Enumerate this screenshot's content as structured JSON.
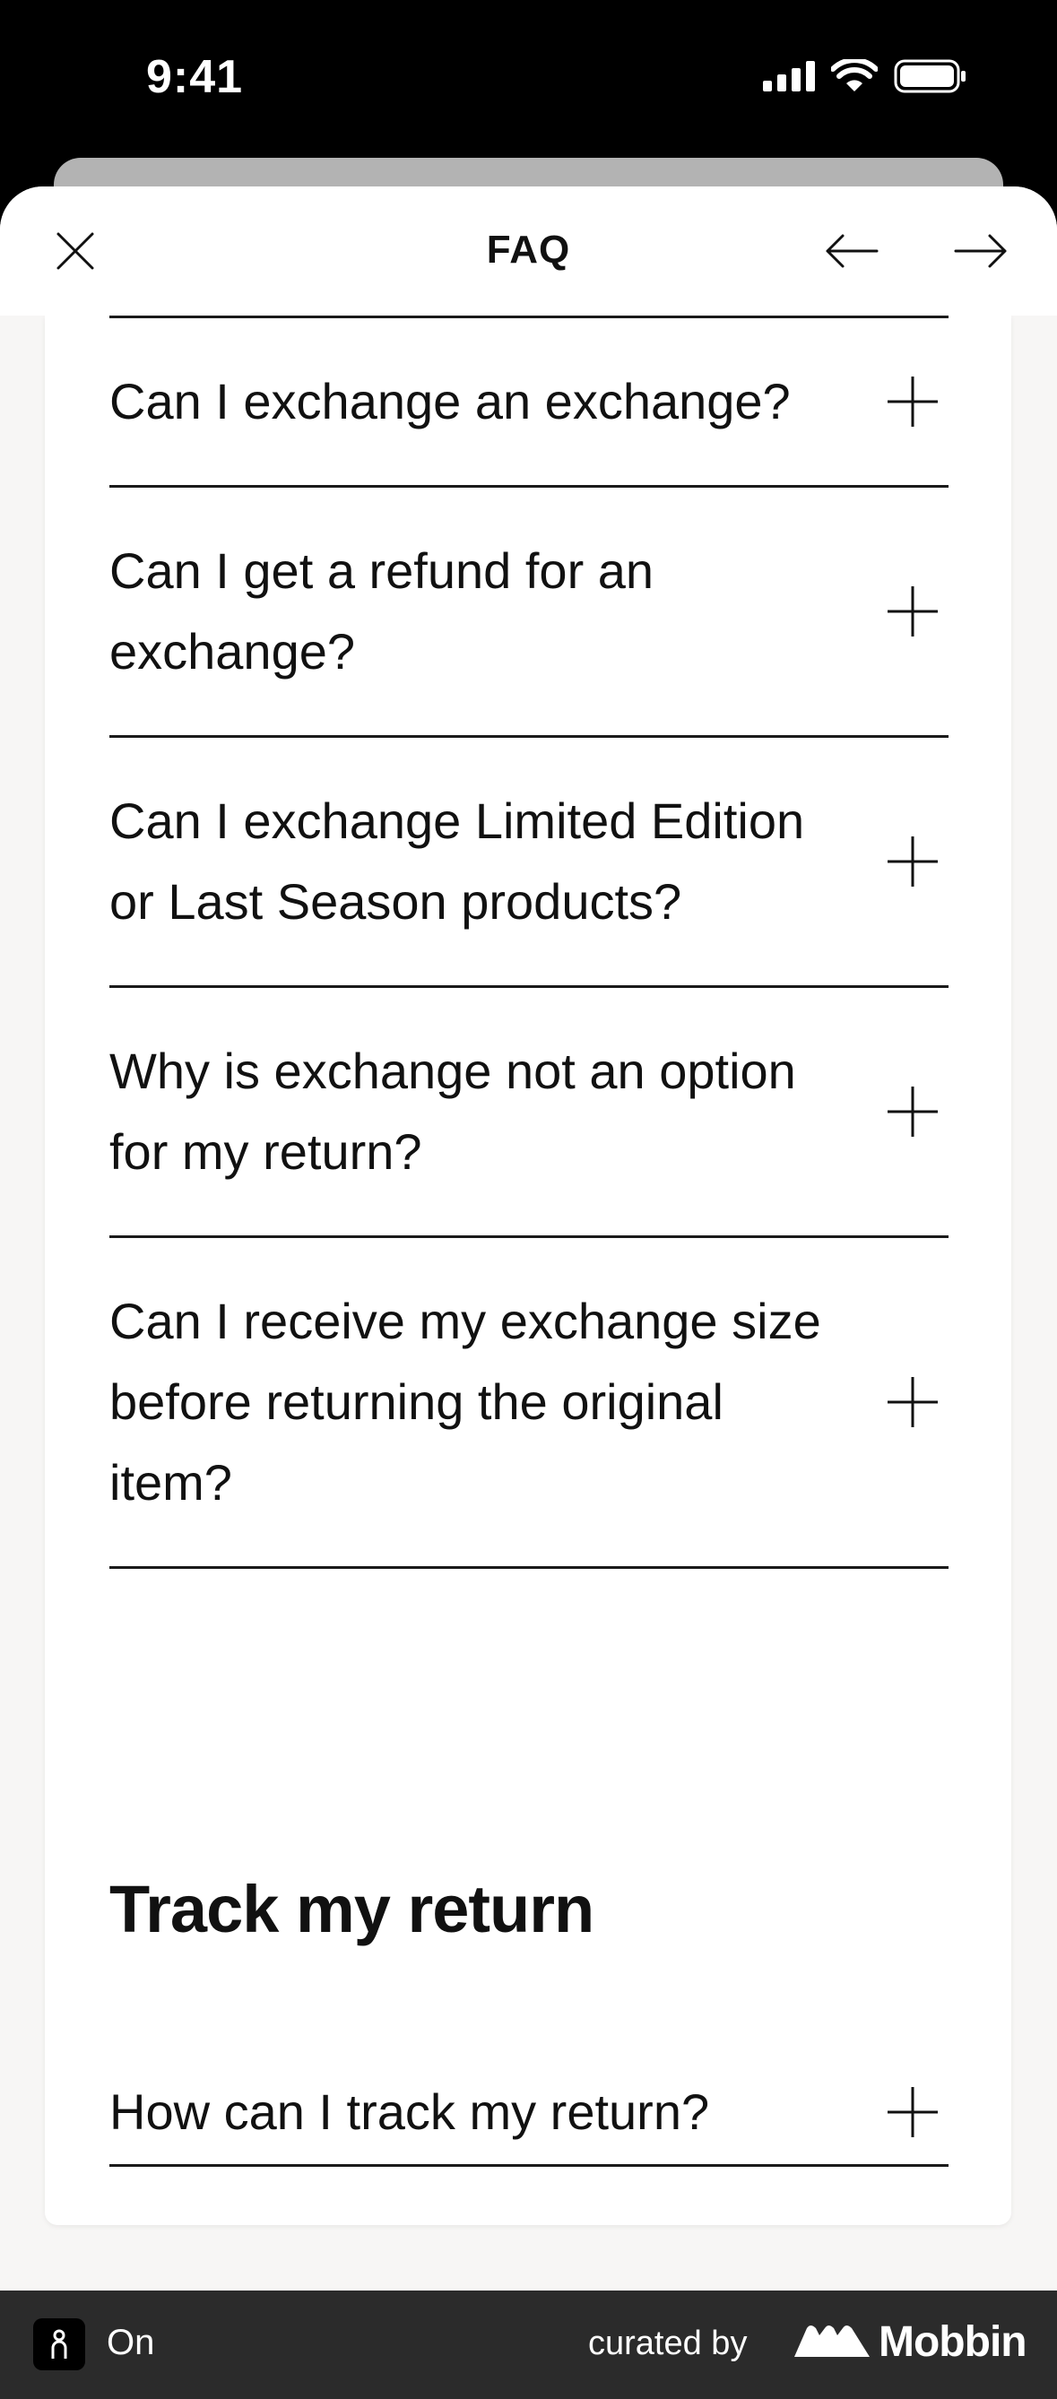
{
  "status_bar": {
    "time": "9:41"
  },
  "header": {
    "title": "FAQ"
  },
  "faq_items": [
    "Can I exchange an exchange?",
    "Can I get a refund for an exchange?",
    "Can I exchange Limited Edition or Last Season products?",
    "Why is exchange not an option for my return?",
    "Can I receive my exchange size before returning the original item?"
  ],
  "section": {
    "title": "Track my return",
    "items": [
      "How can I track my return?"
    ]
  },
  "footer": {
    "app_name": "On",
    "curated_by": "curated by",
    "brand": "Mobbin"
  }
}
